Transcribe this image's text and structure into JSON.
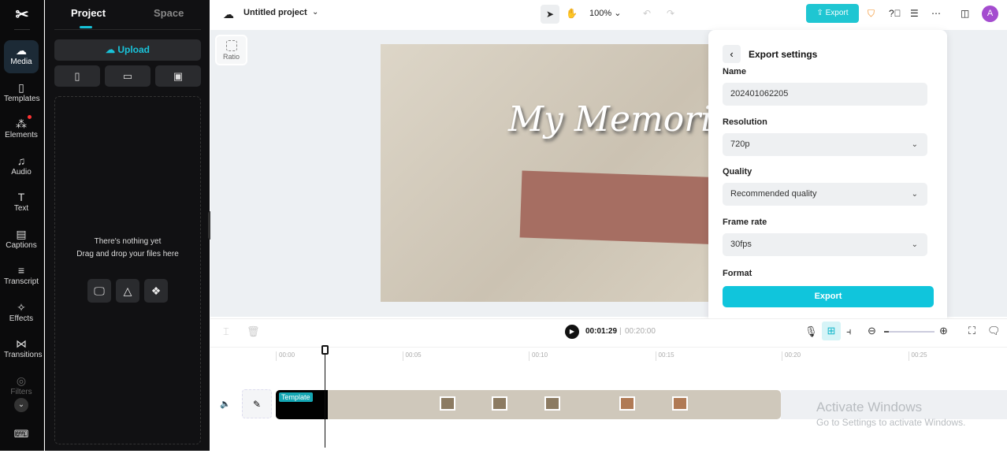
{
  "rail": {
    "items": [
      {
        "label": "Media",
        "icon": "cloud-upload-icon"
      },
      {
        "label": "Templates",
        "icon": "templates-icon"
      },
      {
        "label": "Elements",
        "icon": "elements-icon"
      },
      {
        "label": "Audio",
        "icon": "music-icon"
      },
      {
        "label": "Text",
        "icon": "text-icon"
      },
      {
        "label": "Captions",
        "icon": "captions-icon"
      },
      {
        "label": "Transcript",
        "icon": "transcript-icon"
      },
      {
        "label": "Effects",
        "icon": "effects-icon"
      },
      {
        "label": "Transitions",
        "icon": "transitions-icon"
      },
      {
        "label": "Filters",
        "icon": "filters-icon"
      }
    ]
  },
  "panel": {
    "tabs": [
      "Project",
      "Space"
    ],
    "upload": "Upload",
    "empty_title": "There's nothing yet",
    "empty_sub": "Drag and drop your files here"
  },
  "topbar": {
    "project": "Untitled project",
    "zoom": "100%",
    "export": "Export",
    "avatar": "A"
  },
  "stage": {
    "ratio": "Ratio",
    "video_title": "My Memories"
  },
  "export_settings": {
    "title": "Export settings",
    "name_label": "Name",
    "name_value": "202401062205",
    "resolution_label": "Resolution",
    "resolution_value": "720p",
    "quality_label": "Quality",
    "quality_value": "Recommended quality",
    "framerate_label": "Frame rate",
    "framerate_value": "30fps",
    "format_label": "Format",
    "export_button": "Export"
  },
  "timeline": {
    "current": "00:01:29",
    "separator": "|",
    "duration": "00:20:00",
    "ticks": [
      "00:00",
      "00:05",
      "00:10",
      "00:15",
      "00:20",
      "00:25"
    ],
    "template_badge": "Template",
    "zoom_level": 0.1
  },
  "watermark": {
    "line1": "Activate Windows",
    "line2": "Go to Settings to activate Windows."
  },
  "colors": {
    "accent": "#1fc6d2",
    "avatar": "#a44ccf"
  }
}
